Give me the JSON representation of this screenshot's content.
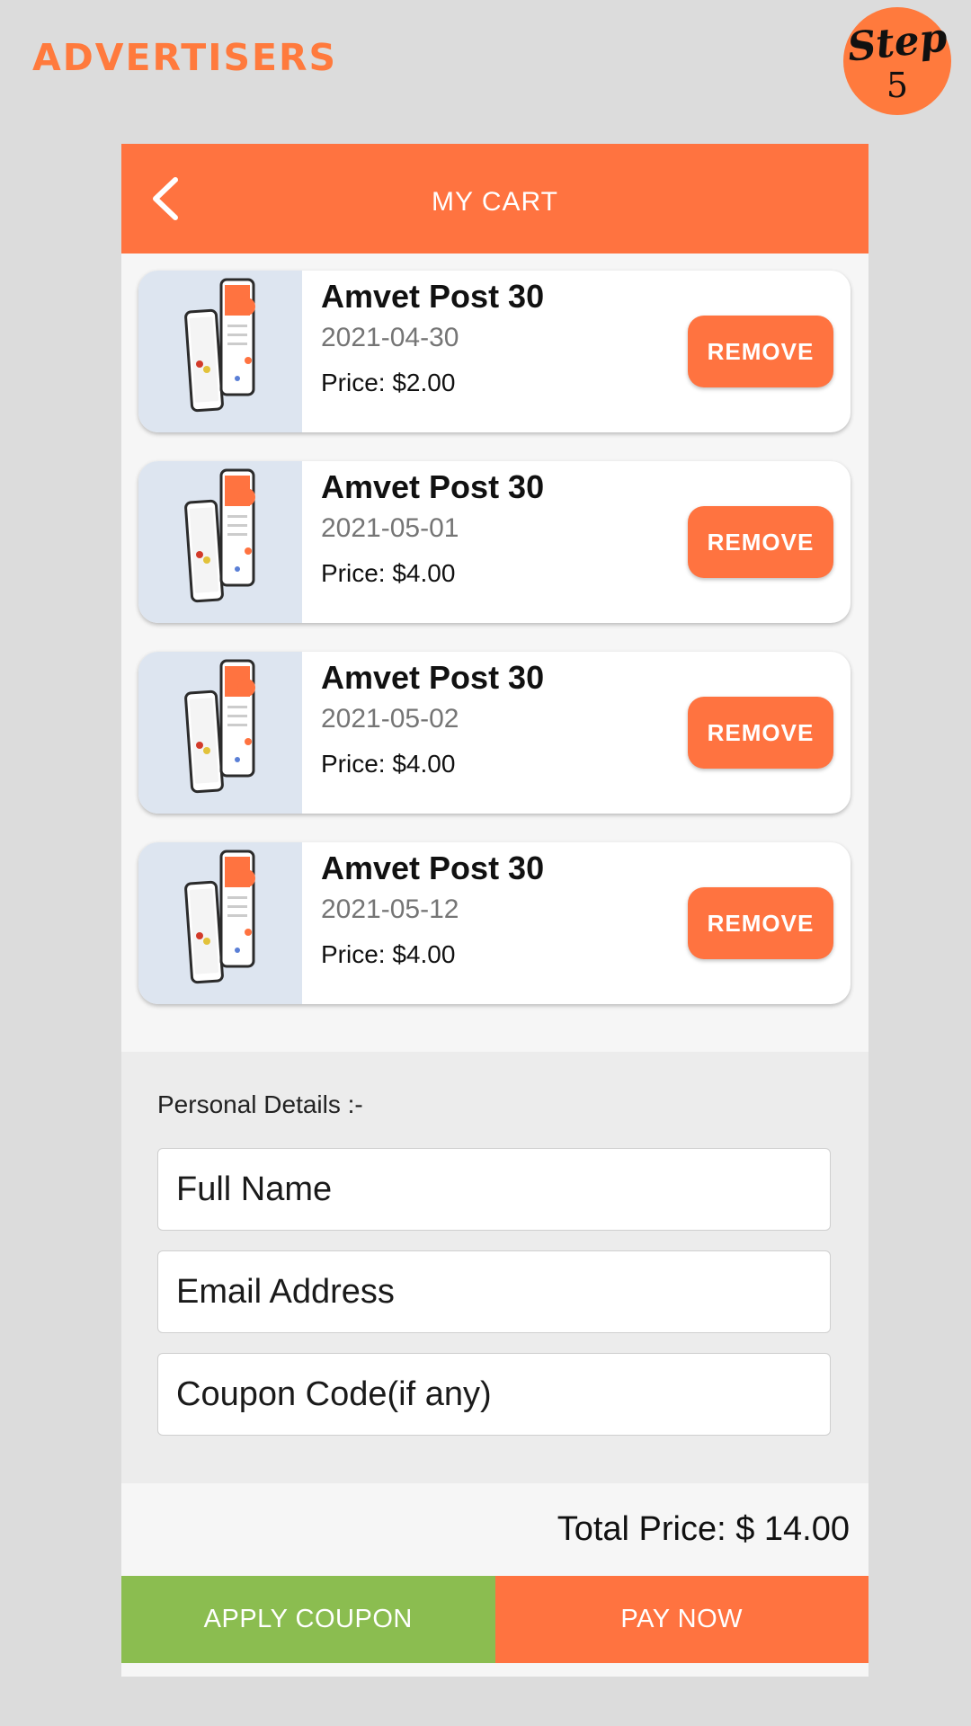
{
  "brand": {
    "label": "ADVERTISERS"
  },
  "step_badge": {
    "word": "Step",
    "number": "5"
  },
  "appbar": {
    "title": "MY CART",
    "back_icon": "chevron-left-icon"
  },
  "cart_items": [
    {
      "title": "Amvet Post 30",
      "date": "2021-04-30",
      "price": "Price: $2.00",
      "remove_label": "REMOVE"
    },
    {
      "title": "Amvet Post 30",
      "date": "2021-05-01",
      "price": "Price: $4.00",
      "remove_label": "REMOVE"
    },
    {
      "title": "Amvet Post 30",
      "date": "2021-05-02",
      "price": "Price: $4.00",
      "remove_label": "REMOVE"
    },
    {
      "title": "Amvet Post 30",
      "date": "2021-05-12",
      "price": "Price: $4.00",
      "remove_label": "REMOVE"
    }
  ],
  "personal_details": {
    "label": "Personal Details :-",
    "full_name": {
      "value": "",
      "placeholder": "Full Name"
    },
    "email": {
      "value": "",
      "placeholder": "Email Address"
    },
    "coupon": {
      "value": "",
      "placeholder": "Coupon Code(if any)"
    }
  },
  "summary": {
    "total": "Total Price: $ 14.00"
  },
  "actions": {
    "apply_coupon": "APPLY COUPON",
    "pay_now": "PAY NOW"
  },
  "colors": {
    "primary": "#ff7340",
    "brand": "#ff7a3d",
    "accept": "#8bbd50",
    "background": "#dcdcdc",
    "thumb_bg": "#dde5f0"
  }
}
